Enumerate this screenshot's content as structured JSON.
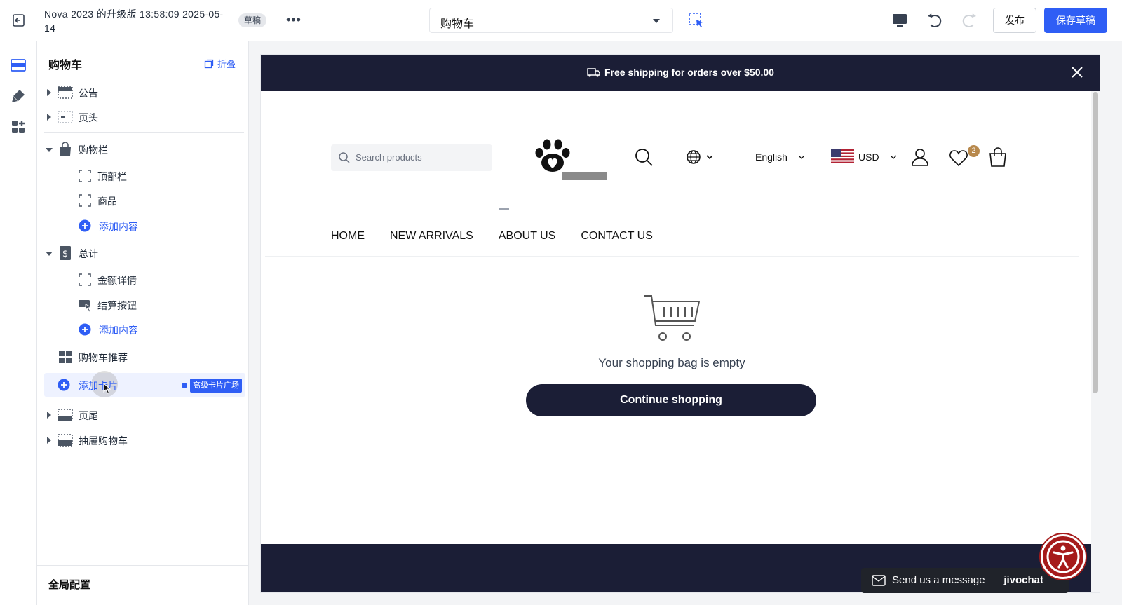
{
  "topbar": {
    "doc_title": "Nova 2023 的升级版 13:58:09 2025-05-14",
    "draft_badge": "草稿",
    "more": "•••",
    "page_select": "购物车",
    "publish": "发布",
    "save_draft": "保存草稿"
  },
  "panel": {
    "title": "购物车",
    "collapse": "折叠",
    "items": [
      {
        "label": "公告"
      },
      {
        "label": "页头"
      },
      {
        "label": "购物栏"
      },
      {
        "label": "顶部栏"
      },
      {
        "label": "商品"
      },
      {
        "label": "添加内容"
      },
      {
        "label": "总计"
      },
      {
        "label": "金额详情"
      },
      {
        "label": "结算按钮"
      },
      {
        "label": "添加内容"
      },
      {
        "label": "购物车推荐"
      },
      {
        "label": "添加卡片"
      },
      {
        "label": "页尾"
      },
      {
        "label": "抽屉购物车"
      }
    ],
    "pro_badge": "高级卡片广场",
    "global_config": "全局配置"
  },
  "preview": {
    "announcement": "Free shipping for orders over $50.00",
    "search_placeholder": "Search products",
    "language": "English",
    "currency": "USD",
    "wishlist_count": "2",
    "nav": [
      "HOME",
      "NEW ARRIVALS",
      "ABOUT US",
      "CONTACT US"
    ],
    "empty_message": "Your shopping bag is empty",
    "continue_button": "Continue shopping",
    "chat_label": "Send us a message",
    "chat_brand": "jivochat"
  },
  "colors": {
    "accent": "#2f5ef5",
    "store_dark": "#1b1e36",
    "badge_gold": "#b8894d",
    "accessibility_red": "#a61b1b"
  }
}
